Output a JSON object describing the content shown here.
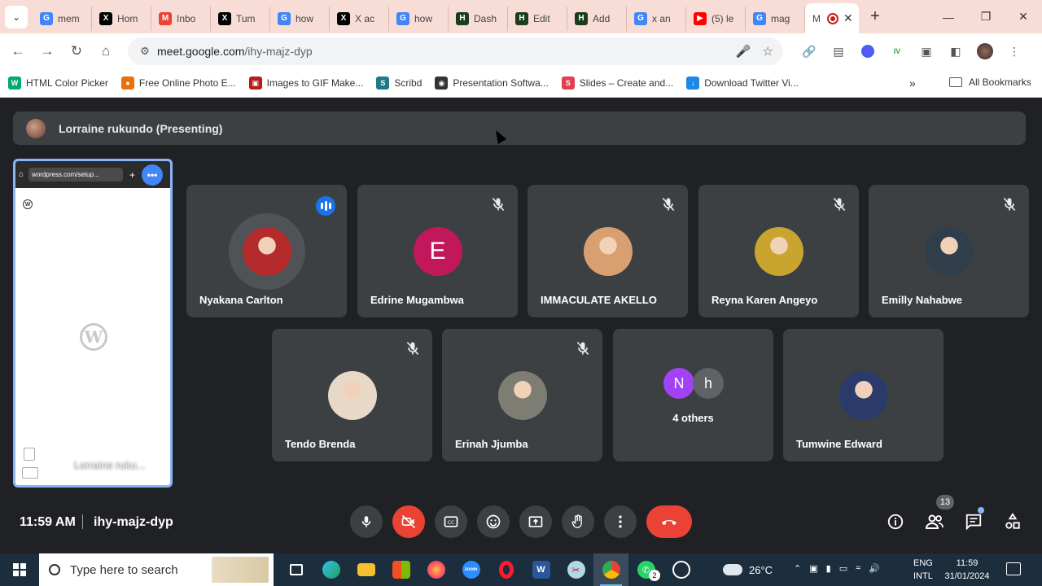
{
  "browser": {
    "tabs": [
      {
        "title": "mem",
        "icon": "google-icon",
        "color": "#4285f4"
      },
      {
        "title": "Hom",
        "icon": "x-icon",
        "color": "#000000"
      },
      {
        "title": "Inbo",
        "icon": "gmail-icon",
        "color": "#ea4335"
      },
      {
        "title": "Tum",
        "icon": "x-icon",
        "color": "#000000"
      },
      {
        "title": "how",
        "icon": "google-icon",
        "color": "#4285f4"
      },
      {
        "title": "X ac",
        "icon": "x-icon",
        "color": "#000000"
      },
      {
        "title": "how",
        "icon": "google-icon",
        "color": "#4285f4"
      },
      {
        "title": "Dash",
        "icon": "hootsuite-icon",
        "color": "#1a3d1a"
      },
      {
        "title": "Edit",
        "icon": "hootsuite-icon",
        "color": "#1a3d1a"
      },
      {
        "title": "Add",
        "icon": "hootsuite-icon",
        "color": "#1a3d1a"
      },
      {
        "title": "x an",
        "icon": "google-icon",
        "color": "#4285f4"
      },
      {
        "title": "(5) le",
        "icon": "youtube-icon",
        "color": "#ff0000"
      },
      {
        "title": "mag",
        "icon": "google-icon",
        "color": "#4285f4"
      }
    ],
    "active_tab": {
      "title": "M",
      "icon": "meet-icon"
    },
    "url_host": "meet.google.com",
    "url_path": "/ihy-majz-dyp",
    "bookmarks": [
      {
        "label": "HTML Color Picker",
        "icon": "w3schools-icon",
        "color": "#04aa6d"
      },
      {
        "label": "Free Online Photo E...",
        "icon": "photo-editor-icon",
        "color": "#e8710a"
      },
      {
        "label": "Images to GIF Make...",
        "icon": "gif-maker-icon",
        "color": "#b71c1c"
      },
      {
        "label": "Scribd",
        "icon": "scribd-icon",
        "color": "#1e7b85"
      },
      {
        "label": "Presentation Softwa...",
        "icon": "globe-icon",
        "color": "#333333"
      },
      {
        "label": "Slides – Create and...",
        "icon": "slides-icon",
        "color": "#e04050"
      },
      {
        "label": "Download Twitter Vi...",
        "icon": "download-icon",
        "color": "#1e88e5"
      }
    ],
    "all_bookmarks": "All Bookmarks"
  },
  "meet": {
    "presenter_banner": "Lorraine rukundo (Presenting)",
    "screen_share": {
      "url": "wordpress.com/setup...",
      "owner": "Lorraine ruku..."
    },
    "participants": [
      {
        "name": "Nyakana Carlton",
        "avatar": "photo",
        "speaking": true,
        "muted": false,
        "bg": "#b52a2a"
      },
      {
        "name": "Edrine Mugambwa",
        "avatar": "letter",
        "letter": "E",
        "muted": true,
        "bg": "#c2185b"
      },
      {
        "name": "IMMACULATE AKELLO",
        "avatar": "photo",
        "muted": true,
        "bg": "#d8a070"
      },
      {
        "name": "Reyna Karen Angeyo",
        "avatar": "photo",
        "muted": true,
        "bg": "#c9a530"
      },
      {
        "name": "Emilly Nahabwe",
        "avatar": "photo-text",
        "muted": true,
        "bg": "#2f3e4a"
      },
      {
        "name": "Tendo Brenda",
        "avatar": "photo",
        "muted": true,
        "bg": "#e7d8c8"
      },
      {
        "name": "Erinah Jjumba",
        "avatar": "photo",
        "muted": true,
        "bg": "#7d7d74"
      },
      {
        "name": "Tumwine Edward",
        "avatar": "photo",
        "muted": false,
        "bg": "#2a3a6a"
      }
    ],
    "others": {
      "label": "4 others",
      "letters": [
        "N",
        "h"
      ],
      "colors": [
        "#a142f4",
        "#5f6368"
      ]
    },
    "time": "11:59 AM",
    "meeting_code": "ihy-majz-dyp",
    "people_count": "13"
  },
  "taskbar": {
    "search_placeholder": "Type here to search",
    "temperature": "26°C",
    "lang_top": "ENG",
    "lang_bottom": "INTL",
    "clock_time": "11:59",
    "clock_date": "31/01/2024",
    "whatsapp_badge": "2"
  }
}
